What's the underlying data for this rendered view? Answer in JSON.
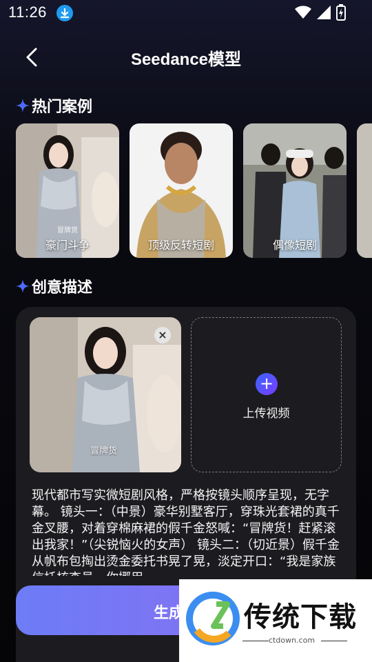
{
  "status_bar": {
    "time": "11:26",
    "icons": [
      "download-icon",
      "wifi-icon",
      "signal-icon",
      "battery-charging-icon"
    ]
  },
  "header": {
    "title": "Seedance模型",
    "back_icon": "chevron-left-icon"
  },
  "hot_cases": {
    "title": "热门案例",
    "items": [
      {
        "label": "豪门斗争",
        "overlay": "冒牌货"
      },
      {
        "label": "顶级反转短剧"
      },
      {
        "label": "偶像短剧"
      },
      {
        "label": ""
      }
    ]
  },
  "creative": {
    "title": "创意描述",
    "reference_image_caption": "冒牌货",
    "upload_label": "上传视频",
    "description": "现代都市写实微短剧风格，严格按镜头顺序呈现，无字幕。 镜头一：（中景）豪华别墅客厅，穿珠光套裙的真千金叉腰，对着穿棉麻裙的假千金怒喊：“冒牌货！赶紧滚出我家！”（尖锐恼火的女声） 镜头二：（切近景）假千金从帆布包掏出烫金委托书晃了晃，淡定开口：“我是家族信托核查员，你挪用"
  },
  "generate_button": {
    "label": "生成"
  },
  "watermark": {
    "text": "传统下载",
    "url": "ctdown.com"
  },
  "colors": {
    "accent": "#6d7cf6",
    "accent2": "#8f6cf2",
    "sparkle": "#4d6bff",
    "panel": "#1c1c20"
  }
}
